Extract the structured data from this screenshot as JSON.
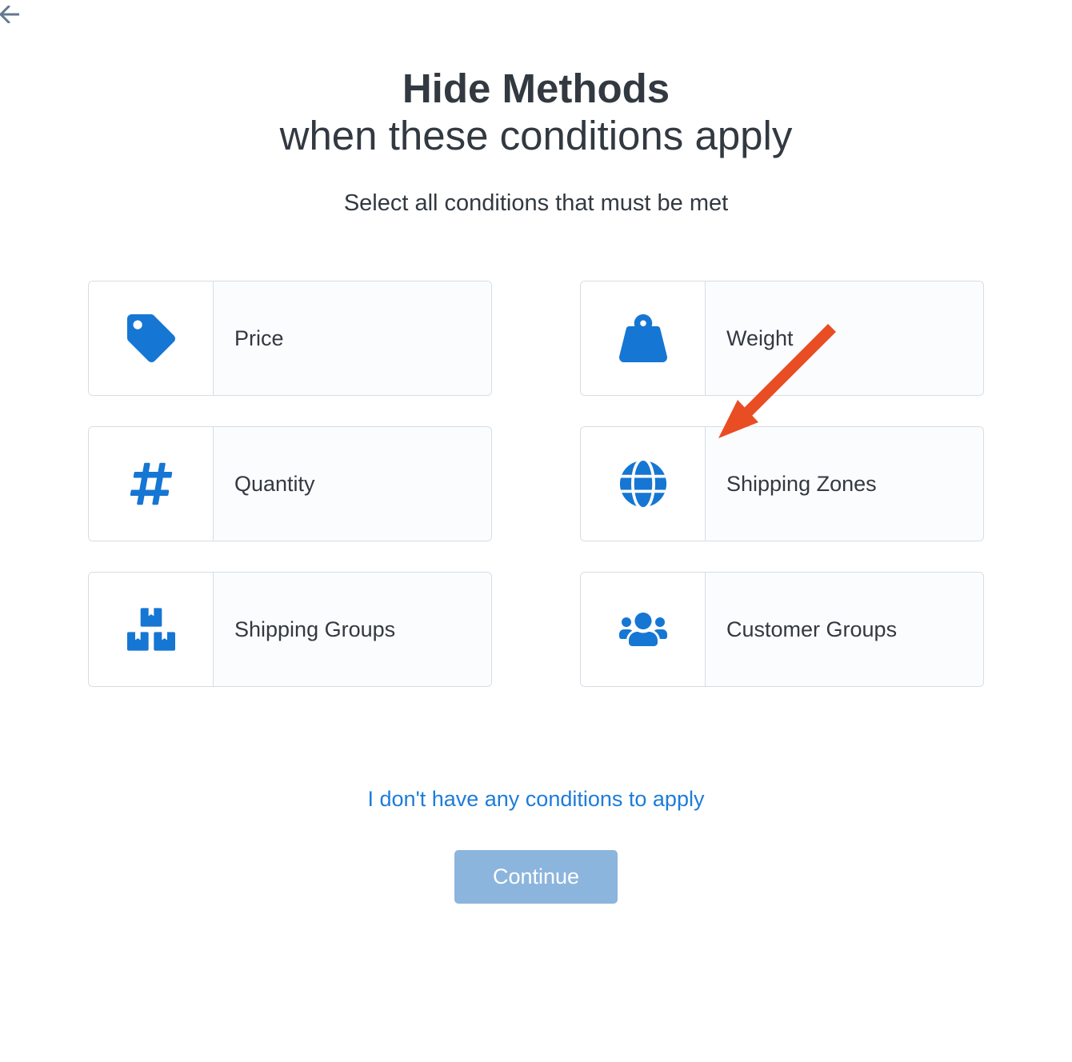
{
  "header": {
    "title": "Hide Methods",
    "subtitle": "when these conditions apply",
    "instruction": "Select all conditions that must be met"
  },
  "cards": [
    {
      "id": "price",
      "label": "Price",
      "icon": "price-tag-icon"
    },
    {
      "id": "weight",
      "label": "Weight",
      "icon": "weight-icon"
    },
    {
      "id": "quantity",
      "label": "Quantity",
      "icon": "hash-icon"
    },
    {
      "id": "shipping-zones",
      "label": "Shipping Zones",
      "icon": "globe-icon"
    },
    {
      "id": "shipping-groups",
      "label": "Shipping Groups",
      "icon": "boxes-icon"
    },
    {
      "id": "customer-groups",
      "label": "Customer Groups",
      "icon": "users-icon"
    }
  ],
  "actions": {
    "skip_link": "I don't have any conditions to apply",
    "continue_label": "Continue"
  },
  "annotation": {
    "arrow_target": "shipping-zones",
    "arrow_color": "#e94d24"
  }
}
